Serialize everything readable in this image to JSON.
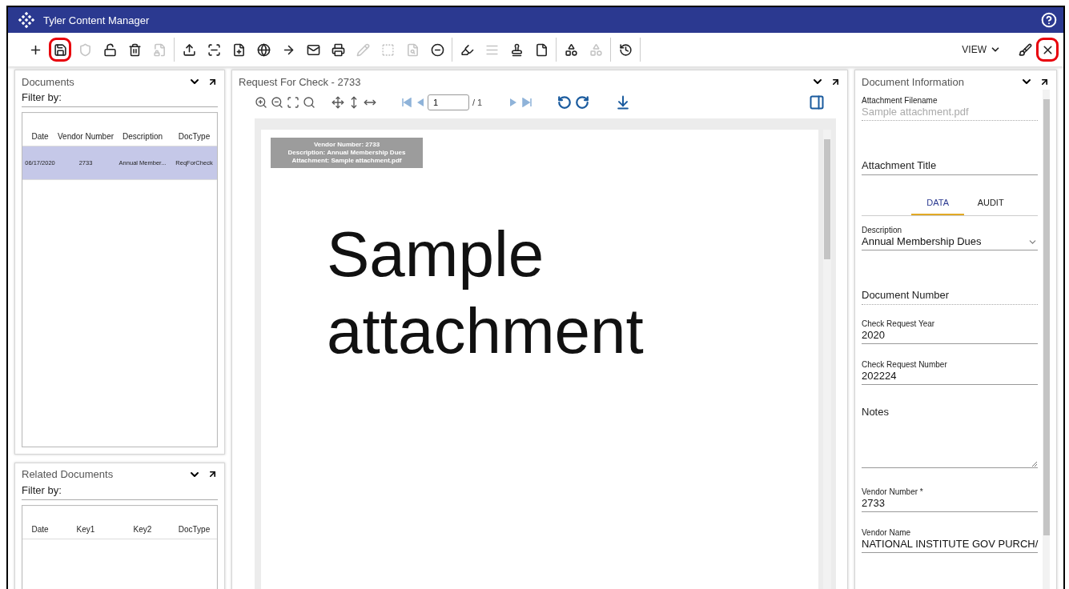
{
  "app": {
    "title": "Tyler Content Manager"
  },
  "toolbar": {
    "groups": [
      [
        {
          "kind": "plus",
          "disabled": false,
          "highlighted": false
        },
        {
          "kind": "save",
          "disabled": false,
          "highlighted": true
        },
        {
          "kind": "shield",
          "disabled": true,
          "highlighted": false
        },
        {
          "kind": "unlock",
          "disabled": false,
          "highlighted": false
        },
        {
          "kind": "trash",
          "disabled": false,
          "highlighted": false
        },
        {
          "kind": "filelock",
          "disabled": true,
          "highlighted": false
        }
      ],
      [
        {
          "kind": "upload",
          "disabled": false,
          "highlighted": false
        },
        {
          "kind": "scan",
          "disabled": false,
          "highlighted": false
        },
        {
          "kind": "fileplus",
          "disabled": false,
          "highlighted": false
        },
        {
          "kind": "globe",
          "disabled": false,
          "highlighted": false
        },
        {
          "kind": "arrow",
          "disabled": false,
          "highlighted": false
        },
        {
          "kind": "mail",
          "disabled": false,
          "highlighted": false
        },
        {
          "kind": "printer",
          "disabled": false,
          "highlighted": false
        },
        {
          "kind": "pencil",
          "disabled": true,
          "highlighted": false
        },
        {
          "kind": "textbox",
          "disabled": true,
          "highlighted": false
        },
        {
          "kind": "filesearch",
          "disabled": true,
          "highlighted": false
        },
        {
          "kind": "minus",
          "disabled": false,
          "highlighted": false
        }
      ],
      [
        {
          "kind": "marker",
          "disabled": false,
          "highlighted": false
        },
        {
          "kind": "lines",
          "disabled": true,
          "highlighted": false
        },
        {
          "kind": "stamp",
          "disabled": false,
          "highlighted": false
        },
        {
          "kind": "file",
          "disabled": false,
          "highlighted": false
        }
      ],
      [
        {
          "kind": "shapes",
          "disabled": false,
          "highlighted": false
        },
        {
          "kind": "shapes",
          "disabled": true,
          "highlighted": false
        }
      ],
      [
        {
          "kind": "history",
          "disabled": false,
          "highlighted": false
        }
      ]
    ],
    "view_label": "VIEW",
    "right": [
      {
        "kind": "brush",
        "disabled": false,
        "highlighted": false
      },
      {
        "kind": "close",
        "disabled": false,
        "highlighted": true
      }
    ]
  },
  "documents": {
    "title": "Documents",
    "filter_label": "Filter by:",
    "columns": [
      "Date",
      "Vendor Number",
      "Description",
      "DocType"
    ],
    "rows": [
      {
        "cells": [
          "06/17/2020",
          "2733",
          "Annual Member...",
          "ReqForCheck"
        ],
        "selected": true
      }
    ]
  },
  "related_documents": {
    "title": "Related Documents",
    "filter_label": "Filter by:",
    "columns": [
      "Date",
      "Key1",
      "Key2",
      "DocType"
    ]
  },
  "viewer": {
    "title": "Request For Check - 2733",
    "page_value": "1",
    "page_total": "/ 1",
    "stamp": [
      "Vendor Number: 2733",
      "Description: Annual Membership Dues",
      "Attachment: Sample attachment.pdf"
    ],
    "body": "Sample attachment"
  },
  "document_information": {
    "title": "Document Information",
    "top_fields": [
      {
        "kind": "text",
        "label": "Attachment Filename",
        "value": "Sample attachment.pdf",
        "readonly": true
      },
      {
        "kind": "placeholder",
        "label": "Attachment Title"
      }
    ],
    "tabs": [
      {
        "label": "DATA",
        "selected": true
      },
      {
        "label": "AUDIT",
        "selected": false
      }
    ],
    "fields": [
      {
        "kind": "select",
        "label": "Description",
        "value": "Annual Membership Dues"
      },
      {
        "kind": "placeholder",
        "label": "Document Number",
        "readonly": true
      },
      {
        "kind": "text",
        "label": "Check Request Year",
        "value": "2020"
      },
      {
        "kind": "text",
        "label": "Check Request Number",
        "value": "202224"
      },
      {
        "kind": "textarea",
        "label": "Notes"
      },
      {
        "kind": "text",
        "label": "Vendor Number *",
        "value": "2733"
      },
      {
        "kind": "text",
        "label": "Vendor Name",
        "value": "NATIONAL INSTITUTE GOV PURCH/"
      }
    ]
  }
}
